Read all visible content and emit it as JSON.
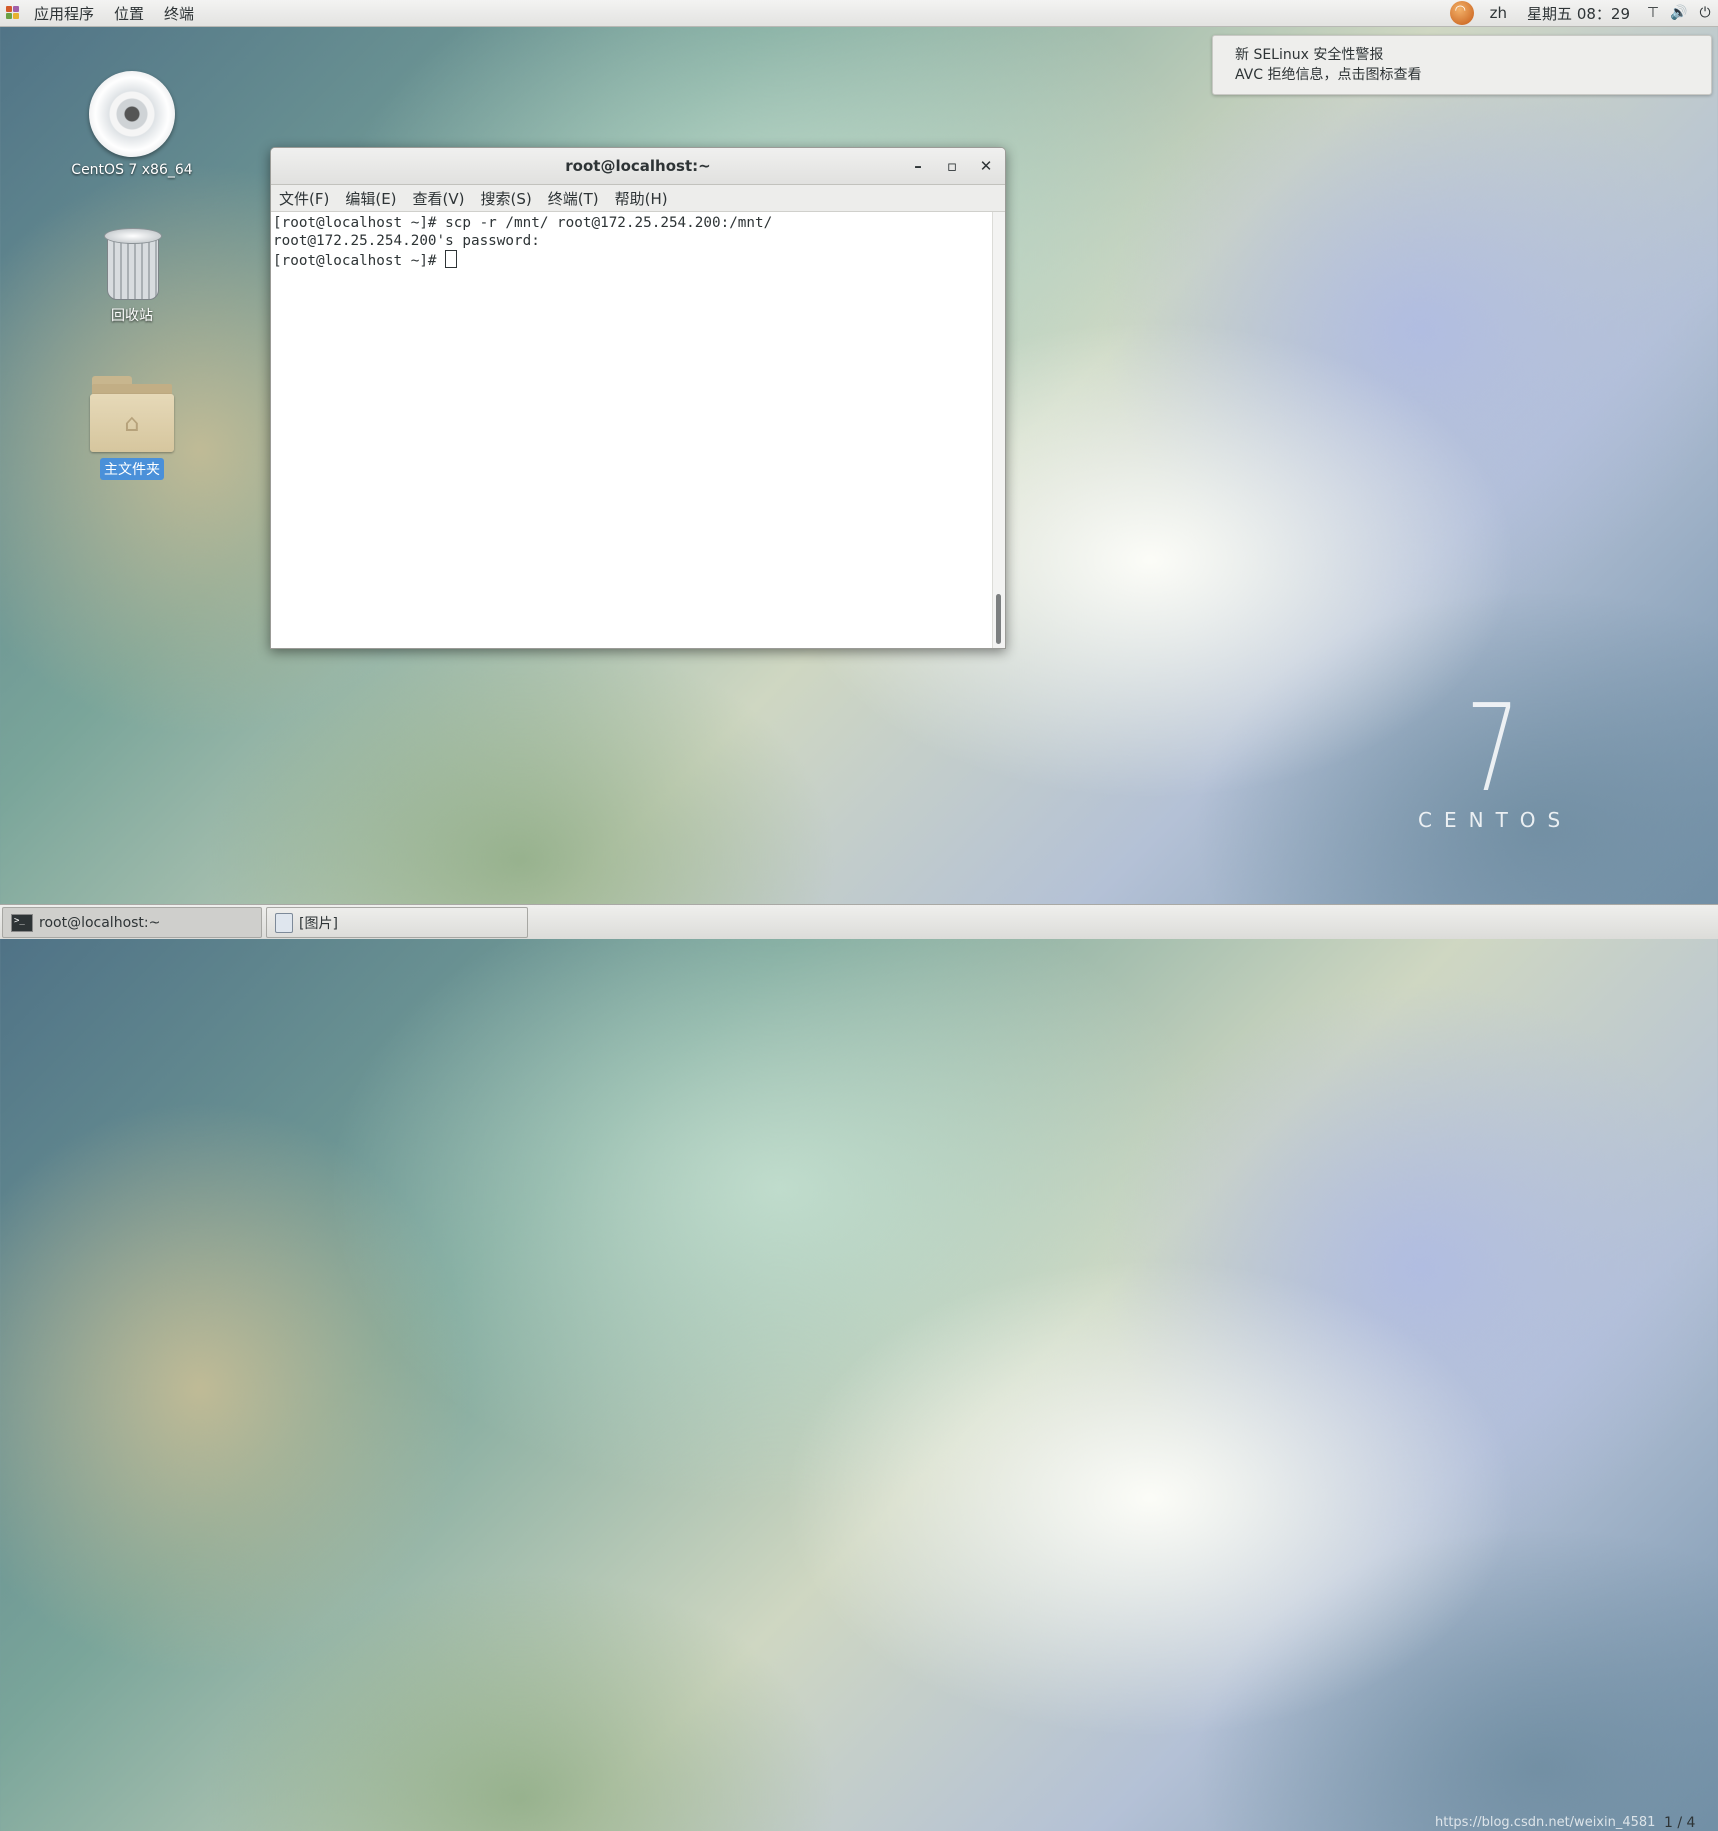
{
  "topbar": {
    "menus": [
      "应用程序",
      "位置",
      "终端"
    ],
    "lang": "zh",
    "clock": "星期五 08：29",
    "icons": [
      "network-icon",
      "volume-icon",
      "power-icon"
    ]
  },
  "notification": {
    "line1": "新 SELinux 安全性警报",
    "line2": "AVC 拒绝信息，点击图标查看"
  },
  "desktop": {
    "icons": [
      {
        "label": "CentOS 7 x86_64",
        "icon": "cd-icon"
      },
      {
        "label": "回收站",
        "icon": "trash-icon"
      },
      {
        "label": "主文件夹",
        "icon": "home-folder-icon"
      }
    ]
  },
  "window": {
    "title": "root@localhost:~",
    "menu": [
      "文件(F)",
      "编辑(E)",
      "查看(V)",
      "搜索(S)",
      "终端(T)",
      "帮助(H)"
    ],
    "lines": [
      "[root@localhost ~]# scp -r /mnt/ root@172.25.254.200:/mnt/",
      "root@172.25.254.200's password:",
      "[root@localhost ~]# "
    ]
  },
  "branding": {
    "number": "7",
    "word": "CENTOS"
  },
  "taskbar": {
    "tasks": [
      "root@localhost:~",
      "[图片]"
    ],
    "watermark": "https://blog.csdn.net/weixin_4581",
    "pager": "1 / 4"
  }
}
